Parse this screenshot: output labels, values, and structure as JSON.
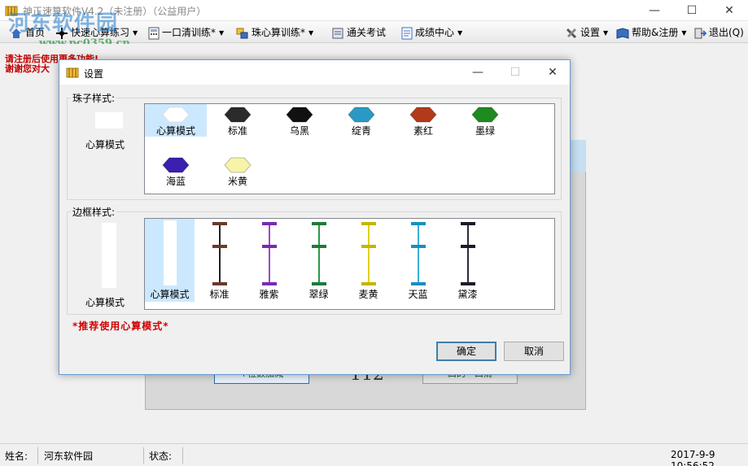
{
  "window": {
    "title": "神正速算软件V4.2（未注册）（公益用户）",
    "minimize": "—",
    "maximize": "☐",
    "close": "✕"
  },
  "watermark": {
    "text": "河东软件园",
    "url": "www.pc0359.cn"
  },
  "toolbar": {
    "items": [
      {
        "label": "首页",
        "icon": "home-icon",
        "has_arrow": false
      },
      {
        "label": "快速心算练习",
        "icon": "target-icon",
        "has_arrow": true
      },
      {
        "label": "一口清训练*",
        "icon": "calculator-icon",
        "has_arrow": true
      },
      {
        "label": "珠心算训练*",
        "icon": "abacus-icon",
        "has_arrow": true
      },
      {
        "label": "通关考试",
        "icon": "exam-icon",
        "has_arrow": false
      },
      {
        "label": "成绩中心",
        "icon": "report-icon",
        "has_arrow": true
      },
      {
        "label": "设置",
        "icon": "tools-icon",
        "has_arrow": true
      },
      {
        "label": "帮助&注册",
        "icon": "book-icon",
        "has_arrow": true
      },
      {
        "label": "退出(Q)",
        "icon": "exit-icon",
        "has_arrow": false
      }
    ]
  },
  "main": {
    "notice_line1": "请注册后使用更多功能!",
    "notice_line2": "谢谢您对大",
    "bg_button_left": "+位数加减",
    "bg_number": "112",
    "bg_button_right": "口的一口清"
  },
  "dialog": {
    "title": "设置",
    "bead_group_label": "珠子样式:",
    "bead_preview_label": "心算模式",
    "bead_options": [
      {
        "label": "心算模式",
        "color": "#ffffff",
        "selected": true
      },
      {
        "label": "标准",
        "color": "#2b2b2b",
        "selected": false
      },
      {
        "label": "乌黑",
        "color": "#111111",
        "selected": false
      },
      {
        "label": "绽青",
        "color": "#2a9ac4",
        "selected": false
      },
      {
        "label": "素红",
        "color": "#b23a1a",
        "selected": false
      },
      {
        "label": "墨绿",
        "color": "#1f8a1f",
        "selected": false
      },
      {
        "label": "海蓝",
        "color": "#3a1fb0",
        "selected": false
      },
      {
        "label": "米黄",
        "color": "#f7f3a8",
        "selected": false
      }
    ],
    "frame_group_label": "边框样式:",
    "frame_preview_label": "心算模式",
    "frame_options": [
      {
        "label": "心算模式",
        "color": "#ffffff",
        "rod": "#ffffff",
        "selected": true
      },
      {
        "label": "标准",
        "color": "#6b3a2a",
        "rod": "#222222",
        "selected": false
      },
      {
        "label": "雅紫",
        "color": "#7a2ab0",
        "rod": "#9a4ad0",
        "selected": false
      },
      {
        "label": "翠绿",
        "color": "#1f7a3a",
        "rod": "#2a9a4a",
        "selected": false
      },
      {
        "label": "麦黄",
        "color": "#c8b400",
        "rod": "#e0d020",
        "selected": false
      },
      {
        "label": "天蓝",
        "color": "#1a8ec0",
        "rod": "#3ab0d8",
        "selected": false
      },
      {
        "label": "黛漆",
        "color": "#1a1a2a",
        "rod": "#2a2a3a",
        "selected": false
      }
    ],
    "recommend": "*推荐使用心算模式*",
    "ok_label": "确定",
    "cancel_label": "取消",
    "minimize": "—",
    "maximize": "☐",
    "close": "✕"
  },
  "status": {
    "name_label": "姓名:",
    "name_value": "河东软件园",
    "state_label": "状态:",
    "state_value": "",
    "datetime": "2017-9-9 10:56:52"
  }
}
